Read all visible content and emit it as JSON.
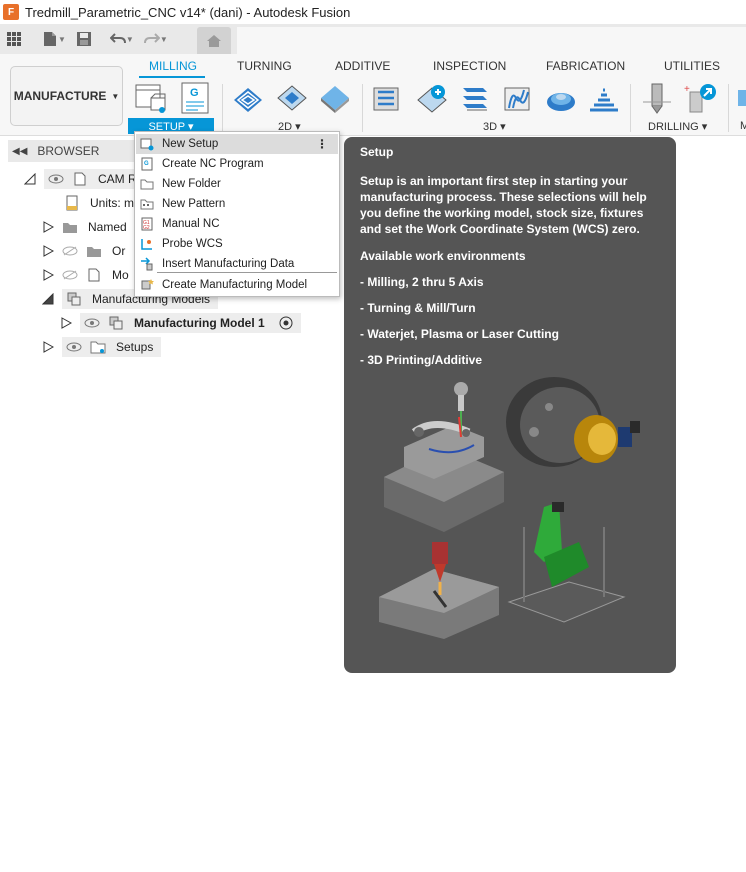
{
  "window": {
    "title": "Tredmill_Parametric_CNC v14* (dani) - Autodesk Fusion",
    "logo_letter": "F"
  },
  "ribbon": {
    "workspace_label": "MANUFACTURE",
    "tabs": [
      {
        "label": "MILLING",
        "active": true
      },
      {
        "label": "TURNING"
      },
      {
        "label": "ADDITIVE"
      },
      {
        "label": "INSPECTION"
      },
      {
        "label": "FABRICATION"
      },
      {
        "label": "UTILITIES"
      }
    ],
    "groups": {
      "setup": "SETUP ▾",
      "twod": "2D ▾",
      "threed": "3D ▾",
      "drilling": "DRILLING ▾",
      "more": "M"
    },
    "accent": "#0696d7"
  },
  "browser": {
    "header": "BROWSER",
    "rows": [
      {
        "label": "CAM R",
        "icon": "document-icon"
      },
      {
        "label": "Units: m",
        "icon": "units-icon"
      },
      {
        "label": "Named",
        "icon": "folder-icon"
      },
      {
        "label": "Or",
        "icon": "folder-icon"
      },
      {
        "label": "Mo",
        "icon": "component-icon"
      },
      {
        "label": "Manufacturing Models",
        "icon": "model-icon"
      },
      {
        "label": "Manufacturing Model 1",
        "icon": "model-icon"
      },
      {
        "label": "Setups",
        "icon": "setup-folder-icon"
      }
    ]
  },
  "setup_menu": {
    "items": [
      {
        "label": "New Setup",
        "icon": "new-setup-icon",
        "highlighted": true
      },
      {
        "label": "Create NC Program",
        "icon": "nc-program-icon"
      },
      {
        "label": "New Folder",
        "icon": "folder-icon"
      },
      {
        "label": "New Pattern",
        "icon": "pattern-icon"
      },
      {
        "label": "Manual NC",
        "icon": "manual-nc-icon"
      },
      {
        "label": "Probe WCS",
        "icon": "probe-icon"
      },
      {
        "label": "Insert Manufacturing Data",
        "icon": "insert-data-icon"
      },
      {
        "label": "Create Manufacturing Model",
        "icon": "mfg-model-icon"
      }
    ]
  },
  "tooltip": {
    "title": "Setup",
    "body": "Setup is an important first step in starting your manufacturing process. These selections will help you define the working model, stock size, fixtures and set the Work Coordinate System (WCS) zero.",
    "envs_heading": "Available work environments",
    "envs": [
      "- Milling, 2 thru 5 Axis",
      "- Turning & Mill/Turn",
      "- Waterjet, Plasma or Laser Cutting",
      "- 3D Printing/Additive"
    ]
  }
}
